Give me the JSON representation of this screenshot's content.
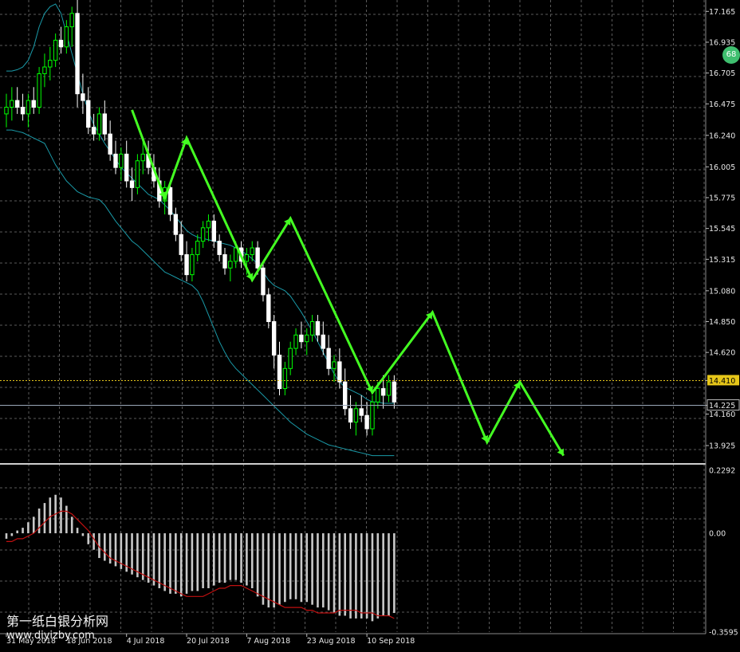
{
  "badge": {
    "text": "68"
  },
  "watermark": {
    "title": "第一纸白银分析网",
    "url": "www.diyizby.com"
  },
  "chart_data": {
    "type": "candlestick",
    "price_panel": {
      "yticks": [
        "17.165",
        "16.935",
        "16.705",
        "16.475",
        "16.240",
        "16.005",
        "15.775",
        "15.545",
        "15.315",
        "15.080",
        "14.850",
        "14.620",
        "14.410",
        "14.225",
        "14.160",
        "13.925"
      ],
      "ylim": [
        13.8,
        17.25
      ],
      "x_count": 114,
      "current_price": 14.225,
      "marked_level": 14.41,
      "colors": {
        "bull": "#00ff00",
        "bear": "#ffffff",
        "band": "#1a9aa8",
        "zigzag": "#44ff22",
        "level": "#e6c619"
      },
      "candles": [
        [
          16.4,
          16.55,
          16.3,
          16.45
        ],
        [
          16.45,
          16.6,
          16.35,
          16.5
        ],
        [
          16.5,
          16.6,
          16.4,
          16.45
        ],
        [
          16.45,
          16.55,
          16.35,
          16.4
        ],
        [
          16.4,
          16.55,
          16.3,
          16.5
        ],
        [
          16.5,
          16.6,
          16.4,
          16.45
        ],
        [
          16.45,
          16.75,
          16.4,
          16.7
        ],
        [
          16.7,
          16.85,
          16.6,
          16.75
        ],
        [
          16.75,
          16.9,
          16.65,
          16.8
        ],
        [
          16.8,
          17.0,
          16.75,
          16.95
        ],
        [
          16.95,
          17.05,
          16.85,
          16.9
        ],
        [
          16.9,
          17.1,
          16.85,
          17.05
        ],
        [
          17.05,
          17.2,
          16.9,
          17.15
        ],
        [
          17.15,
          17.25,
          16.45,
          16.55
        ],
        [
          16.55,
          16.7,
          16.4,
          16.5
        ],
        [
          16.5,
          16.6,
          16.25,
          16.3
        ],
        [
          16.3,
          16.4,
          16.2,
          16.25
        ],
        [
          16.25,
          16.45,
          16.2,
          16.4
        ],
        [
          16.4,
          16.5,
          16.2,
          16.25
        ],
        [
          16.25,
          16.35,
          16.05,
          16.1
        ],
        [
          16.1,
          16.2,
          15.95,
          16.0
        ],
        [
          16.0,
          16.15,
          15.9,
          16.1
        ],
        [
          16.1,
          16.2,
          15.85,
          15.9
        ],
        [
          15.9,
          16.0,
          15.75,
          15.85
        ],
        [
          15.85,
          16.1,
          15.8,
          16.05
        ],
        [
          16.05,
          16.2,
          15.95,
          16.1
        ],
        [
          16.1,
          16.2,
          15.95,
          16.0
        ],
        [
          16.0,
          16.1,
          15.85,
          15.9
        ],
        [
          15.9,
          16.0,
          15.7,
          15.75
        ],
        [
          15.75,
          15.9,
          15.65,
          15.85
        ],
        [
          15.85,
          15.9,
          15.6,
          15.65
        ],
        [
          15.65,
          15.7,
          15.45,
          15.5
        ],
        [
          15.5,
          15.6,
          15.3,
          15.35
        ],
        [
          15.35,
          15.45,
          15.15,
          15.2
        ],
        [
          15.2,
          15.4,
          15.15,
          15.35
        ],
        [
          15.35,
          15.5,
          15.3,
          15.45
        ],
        [
          15.45,
          15.6,
          15.4,
          15.55
        ],
        [
          15.55,
          15.65,
          15.45,
          15.6
        ],
        [
          15.6,
          15.65,
          15.4,
          15.45
        ],
        [
          15.45,
          15.5,
          15.3,
          15.35
        ],
        [
          15.35,
          15.4,
          15.2,
          15.25
        ],
        [
          15.25,
          15.35,
          15.15,
          15.3
        ],
        [
          15.3,
          15.45,
          15.25,
          15.4
        ],
        [
          15.4,
          15.45,
          15.25,
          15.3
        ],
        [
          15.3,
          15.4,
          15.2,
          15.35
        ],
        [
          15.35,
          15.45,
          15.3,
          15.4
        ],
        [
          15.4,
          15.45,
          15.2,
          15.25
        ],
        [
          15.25,
          15.3,
          15.0,
          15.05
        ],
        [
          15.05,
          15.1,
          14.8,
          14.85
        ],
        [
          14.85,
          14.9,
          14.5,
          14.6
        ],
        [
          14.6,
          14.7,
          14.3,
          14.35
        ],
        [
          14.35,
          14.55,
          14.3,
          14.5
        ],
        [
          14.5,
          14.7,
          14.45,
          14.65
        ],
        [
          14.65,
          14.8,
          14.6,
          14.75
        ],
        [
          14.75,
          14.85,
          14.65,
          14.7
        ],
        [
          14.7,
          14.8,
          14.6,
          14.75
        ],
        [
          14.75,
          14.9,
          14.7,
          14.85
        ],
        [
          14.85,
          14.9,
          14.7,
          14.75
        ],
        [
          14.75,
          14.85,
          14.6,
          14.65
        ],
        [
          14.65,
          14.75,
          14.45,
          14.5
        ],
        [
          14.5,
          14.6,
          14.4,
          14.55
        ],
        [
          14.55,
          14.65,
          14.35,
          14.4
        ],
        [
          14.4,
          14.5,
          14.15,
          14.2
        ],
        [
          14.2,
          14.3,
          14.05,
          14.1
        ],
        [
          14.1,
          14.25,
          14.0,
          14.2
        ],
        [
          14.2,
          14.3,
          14.1,
          14.15
        ],
        [
          14.15,
          14.25,
          14.0,
          14.05
        ],
        [
          14.05,
          14.3,
          14.0,
          14.25
        ],
        [
          14.25,
          14.4,
          14.2,
          14.35
        ],
        [
          14.35,
          14.45,
          14.2,
          14.3
        ],
        [
          14.3,
          14.45,
          14.25,
          14.4
        ],
        [
          14.4,
          14.45,
          14.2,
          14.25
        ]
      ],
      "bb_upper": [
        16.72,
        16.72,
        16.73,
        16.75,
        16.8,
        16.9,
        17.05,
        17.15,
        17.2,
        17.22,
        17.15,
        17.0,
        16.85,
        16.7,
        16.55,
        16.42,
        16.32,
        16.25,
        16.18,
        16.12,
        16.06,
        16.0,
        15.96,
        15.92,
        15.88,
        15.84,
        15.8,
        15.78,
        15.76,
        15.72,
        15.68,
        15.63,
        15.58,
        15.53,
        15.5,
        15.48,
        15.47,
        15.46,
        15.45,
        15.44,
        15.43,
        15.42,
        15.4,
        15.38,
        15.35,
        15.32,
        15.28,
        15.22,
        15.16,
        15.12,
        15.1,
        15.08,
        15.04,
        14.98,
        14.92,
        14.85,
        14.78,
        14.7,
        14.62,
        14.54,
        14.46,
        14.4,
        14.36,
        14.34,
        14.32,
        14.3,
        14.27,
        14.25,
        14.25,
        14.24,
        14.24,
        14.24
      ],
      "bb_lower": [
        16.28,
        16.28,
        16.27,
        16.26,
        16.24,
        16.22,
        16.2,
        16.18,
        16.1,
        16.02,
        15.96,
        15.9,
        15.86,
        15.82,
        15.8,
        15.78,
        15.77,
        15.76,
        15.72,
        15.66,
        15.6,
        15.55,
        15.5,
        15.45,
        15.42,
        15.38,
        15.34,
        15.3,
        15.26,
        15.22,
        15.2,
        15.18,
        15.16,
        15.14,
        15.12,
        15.08,
        15.0,
        14.9,
        14.8,
        14.7,
        14.62,
        14.55,
        14.5,
        14.46,
        14.42,
        14.38,
        14.34,
        14.3,
        14.26,
        14.22,
        14.18,
        14.14,
        14.1,
        14.07,
        14.04,
        14.01,
        13.99,
        13.97,
        13.95,
        13.93,
        13.92,
        13.91,
        13.9,
        13.89,
        13.88,
        13.87,
        13.86,
        13.85,
        13.85,
        13.85,
        13.85,
        13.85
      ],
      "zigzag": [
        [
          16.43,
          23
        ],
        [
          15.77,
          29
        ],
        [
          16.22,
          33
        ],
        [
          15.16,
          45
        ],
        [
          15.62,
          52
        ],
        [
          14.32,
          67
        ],
        [
          14.92,
          78
        ],
        [
          13.95,
          88
        ],
        [
          14.4,
          94
        ],
        [
          13.85,
          102
        ]
      ]
    },
    "macd_panel": {
      "yticks": [
        "0.2292",
        "0.00",
        "-0.3595"
      ],
      "ylim": [
        -0.3595,
        0.2292
      ],
      "hist_color": "#c8c8c8",
      "signal_color": "#c01010",
      "histogram": [
        -0.02,
        -0.01,
        0.01,
        0.02,
        0.04,
        0.06,
        0.09,
        0.11,
        0.13,
        0.14,
        0.13,
        0.1,
        0.06,
        0.02,
        -0.01,
        -0.04,
        -0.06,
        -0.09,
        -0.1,
        -0.11,
        -0.12,
        -0.13,
        -0.14,
        -0.15,
        -0.16,
        -0.17,
        -0.18,
        -0.19,
        -0.2,
        -0.21,
        -0.22,
        -0.22,
        -0.23,
        -0.22,
        -0.21,
        -0.21,
        -0.2,
        -0.2,
        -0.19,
        -0.18,
        -0.18,
        -0.17,
        -0.17,
        -0.18,
        -0.19,
        -0.2,
        -0.23,
        -0.26,
        -0.27,
        -0.27,
        -0.26,
        -0.25,
        -0.24,
        -0.24,
        -0.25,
        -0.25,
        -0.26,
        -0.27,
        -0.27,
        -0.28,
        -0.29,
        -0.3,
        -0.3,
        -0.31,
        -0.31,
        -0.31,
        -0.31,
        -0.32,
        -0.31,
        -0.3,
        -0.3,
        -0.29
      ],
      "signal": [
        -0.03,
        -0.03,
        -0.02,
        -0.02,
        -0.01,
        0.0,
        0.02,
        0.04,
        0.06,
        0.07,
        0.08,
        0.08,
        0.07,
        0.05,
        0.03,
        0.01,
        -0.02,
        -0.05,
        -0.07,
        -0.09,
        -0.1,
        -0.11,
        -0.12,
        -0.13,
        -0.14,
        -0.15,
        -0.16,
        -0.17,
        -0.18,
        -0.19,
        -0.2,
        -0.21,
        -0.22,
        -0.23,
        -0.23,
        -0.23,
        -0.23,
        -0.22,
        -0.21,
        -0.2,
        -0.2,
        -0.19,
        -0.19,
        -0.19,
        -0.2,
        -0.21,
        -0.22,
        -0.23,
        -0.24,
        -0.25,
        -0.26,
        -0.27,
        -0.27,
        -0.27,
        -0.27,
        -0.28,
        -0.28,
        -0.29,
        -0.29,
        -0.29,
        -0.29,
        -0.28,
        -0.28,
        -0.28,
        -0.28,
        -0.29,
        -0.29,
        -0.29,
        -0.3,
        -0.3,
        -0.3,
        -0.31
      ]
    },
    "x_labels": [
      {
        "label": "31 May 2018",
        "index": 0
      },
      {
        "label": "18 Jun 2018",
        "index": 11
      },
      {
        "label": "4 Jul 2018",
        "index": 22
      },
      {
        "label": "20 Jul 2018",
        "index": 33
      },
      {
        "label": "7 Aug 2018",
        "index": 44
      },
      {
        "label": "23 Aug 2018",
        "index": 55
      },
      {
        "label": "10 Sep 2018",
        "index": 66
      }
    ]
  }
}
